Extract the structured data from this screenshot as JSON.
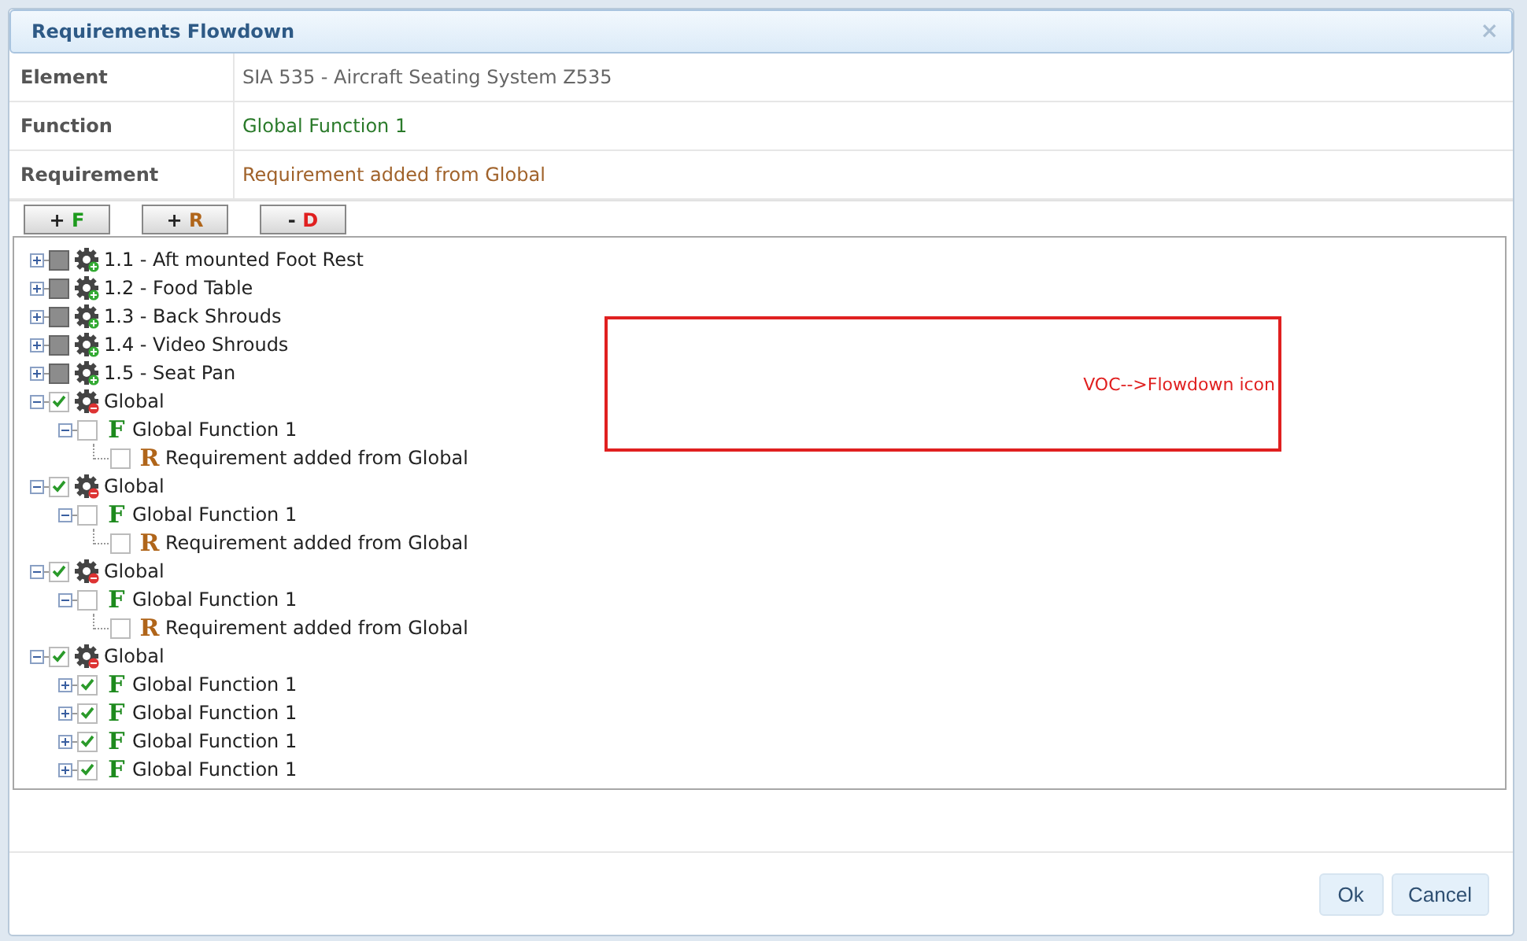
{
  "dialog": {
    "title": "Requirements Flowdown",
    "close": "×"
  },
  "details": [
    {
      "label": "Element",
      "value": "SIA 535 - Aircraft Seating System Z535",
      "kind": "element"
    },
    {
      "label": "Function",
      "value": "Global Function 1",
      "kind": "function"
    },
    {
      "label": "Requirement",
      "value": "Requirement added from Global",
      "kind": "requirement"
    }
  ],
  "toolbar": [
    {
      "sign": "+",
      "letter": "F",
      "kind": "function"
    },
    {
      "sign": "+",
      "letter": "R",
      "kind": "requirement"
    },
    {
      "sign": "-",
      "letter": "D",
      "kind": "delete"
    }
  ],
  "tree": [
    {
      "kind": "element",
      "label": "1.1 - Aft mounted Foot Rest",
      "expanded": false,
      "checked": false,
      "disabled": true
    },
    {
      "kind": "element",
      "label": "1.2 - Food Table",
      "expanded": false,
      "checked": false,
      "disabled": true
    },
    {
      "kind": "element",
      "label": "1.3 - Back Shrouds",
      "expanded": false,
      "checked": false,
      "disabled": true
    },
    {
      "kind": "element",
      "label": "1.4 - Video Shrouds",
      "expanded": false,
      "checked": false,
      "disabled": true
    },
    {
      "kind": "element",
      "label": "1.5 - Seat Pan",
      "expanded": false,
      "checked": false,
      "disabled": true
    },
    {
      "kind": "global",
      "label": "Global",
      "expanded": true,
      "checked": true,
      "disabled": false,
      "children": [
        {
          "kind": "function",
          "letter": "F",
          "label": "Global Function 1",
          "expanded": true,
          "checked": false,
          "disabled": false,
          "children": [
            {
              "kind": "requirement",
              "letter": "R",
              "label": "Requirement added from Global",
              "checked": false,
              "disabled": false
            }
          ]
        }
      ]
    },
    {
      "kind": "global",
      "label": "Global",
      "expanded": true,
      "checked": true,
      "disabled": false,
      "children": [
        {
          "kind": "function",
          "letter": "F",
          "label": "Global Function 1",
          "expanded": true,
          "checked": false,
          "disabled": false,
          "children": [
            {
              "kind": "requirement",
              "letter": "R",
              "label": "Requirement added from Global",
              "checked": false,
              "disabled": false
            }
          ]
        }
      ]
    },
    {
      "kind": "global",
      "label": "Global",
      "expanded": true,
      "checked": true,
      "disabled": false,
      "children": [
        {
          "kind": "function",
          "letter": "F",
          "label": "Global Function 1",
          "expanded": true,
          "checked": false,
          "disabled": false,
          "children": [
            {
              "kind": "requirement",
              "letter": "R",
              "label": "Requirement added from Global",
              "checked": false,
              "disabled": false
            }
          ]
        }
      ]
    },
    {
      "kind": "global",
      "label": "Global",
      "expanded": true,
      "checked": true,
      "disabled": false,
      "children": [
        {
          "kind": "function",
          "letter": "F",
          "label": "Global Function 1",
          "expanded": false,
          "checked": true,
          "disabled": false
        },
        {
          "kind": "function",
          "letter": "F",
          "label": "Global Function 1",
          "expanded": false,
          "checked": true,
          "disabled": false
        },
        {
          "kind": "function",
          "letter": "F",
          "label": "Global Function 1",
          "expanded": false,
          "checked": true,
          "disabled": false
        },
        {
          "kind": "function",
          "letter": "F",
          "label": "Global Function 1",
          "expanded": false,
          "checked": true,
          "disabled": false
        }
      ]
    }
  ],
  "annotation": {
    "text": "VOC-->Flowdown icon"
  },
  "footer": {
    "buttons": [
      "Ok",
      "Cancel"
    ]
  }
}
